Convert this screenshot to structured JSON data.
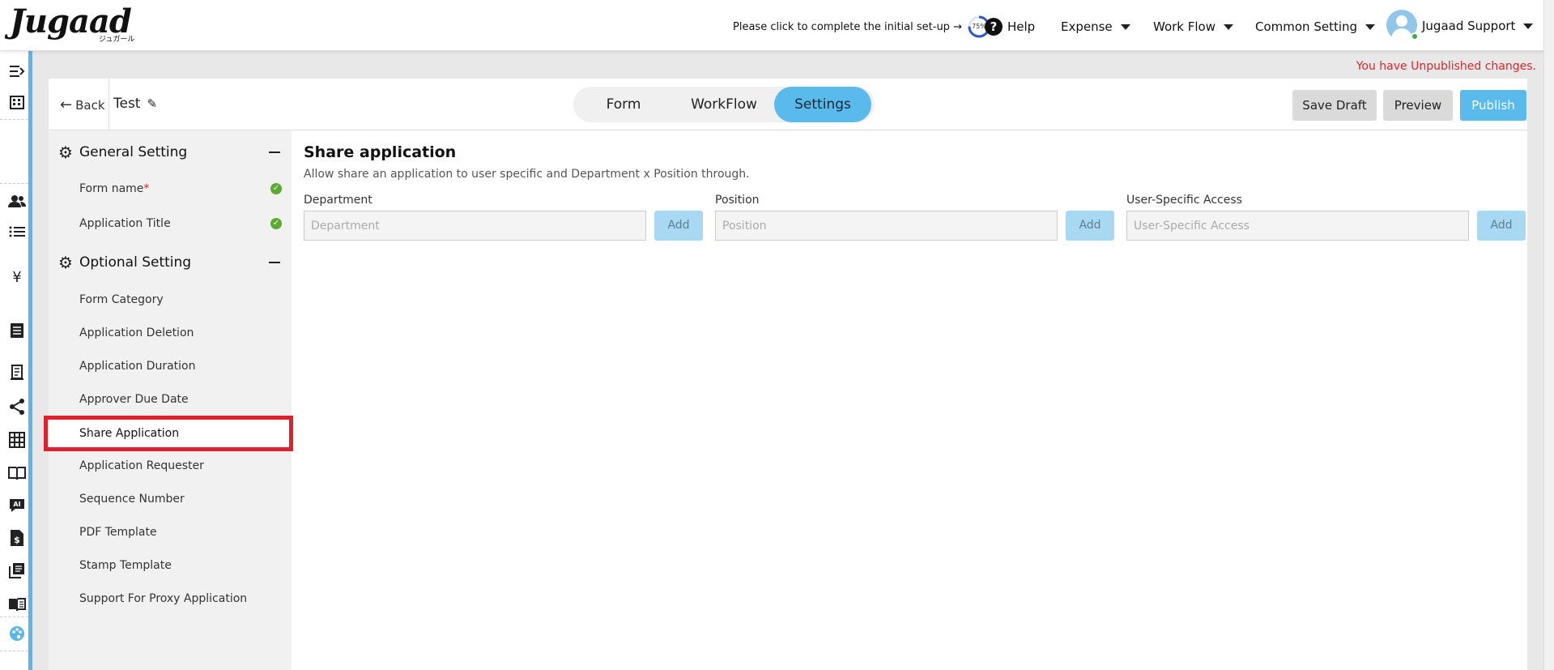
{
  "brand": {
    "logo_text": "Jugaad",
    "logo_sub": "ジュガール"
  },
  "header": {
    "setup_text": "Please click to complete the initial set-up →",
    "setup_progress": "75%",
    "setup_progress_value": 0.75,
    "help": "Help",
    "menus": [
      "Expense",
      "Work Flow",
      "Common Setting"
    ],
    "user_name": "Jugaad Support"
  },
  "notice": "You have Unpublished changes.",
  "editor": {
    "back": "Back",
    "form_title": "Test",
    "tabs": [
      {
        "label": "Form",
        "active": false
      },
      {
        "label": "WorkFlow",
        "active": false
      },
      {
        "label": "Settings",
        "active": true
      }
    ],
    "buttons": {
      "save_draft": "Save Draft",
      "preview": "Preview",
      "publish": "Publish"
    }
  },
  "sidebar": {
    "general": {
      "title": "General Setting",
      "items": [
        {
          "label": "Form name",
          "required_mark": "*",
          "done": true
        },
        {
          "label": "Application Title",
          "done": true
        }
      ]
    },
    "optional": {
      "title": "Optional Setting",
      "items": [
        "Form Category",
        "Application Deletion",
        "Application Duration",
        "Approver Due Date",
        "Share Application",
        "Application Requester",
        "Sequence Number",
        "PDF Template",
        "Stamp Template",
        "Support For Proxy Application"
      ],
      "selected": "Share Application"
    }
  },
  "content": {
    "title": "Share application",
    "description": "Allow share an application to user specific and Department x Position through.",
    "fields": [
      {
        "label": "Department",
        "placeholder": "Department",
        "add": "Add"
      },
      {
        "label": "Position",
        "placeholder": "Position",
        "add": "Add"
      },
      {
        "label": "User-Specific Access",
        "placeholder": "User-Specific Access",
        "add": "Add"
      }
    ]
  },
  "colors": {
    "accent": "#5bbaec",
    "alert": "#d9262c",
    "highlight": "#e0202b",
    "check": "#5aab2f"
  }
}
